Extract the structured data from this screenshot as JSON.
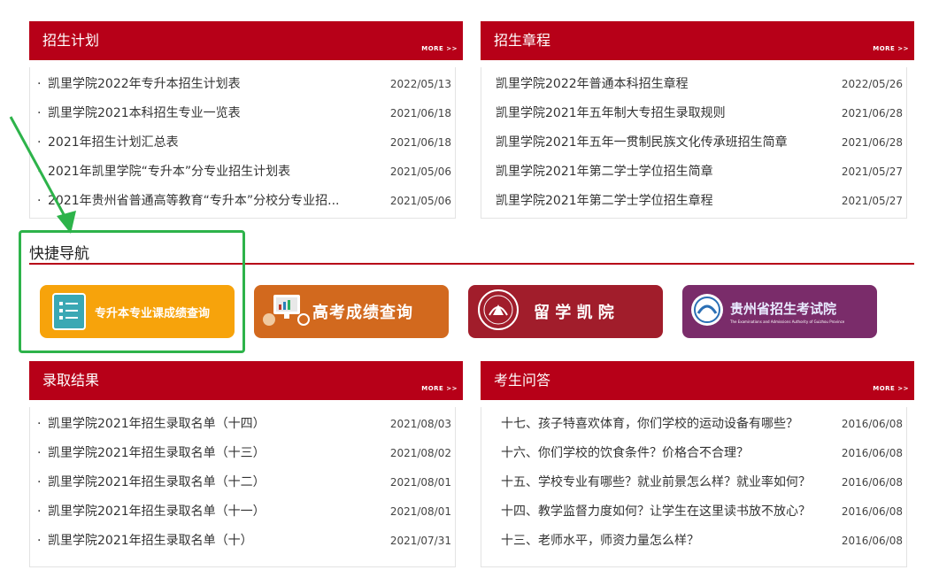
{
  "more_label": "MORE >>",
  "plan": {
    "title": "招生计划",
    "items": [
      {
        "title": "凯里学院2022年专升本招生计划表",
        "date": "2022/05/13"
      },
      {
        "title": "凯里学院2021本科招生专业一览表",
        "date": "2021/06/18"
      },
      {
        "title": "2021年招生计划汇总表",
        "date": "2021/06/18"
      },
      {
        "title": "2021年凯里学院“专升本”分专业招生计划表",
        "date": "2021/05/06"
      },
      {
        "title": "2021年贵州省普通高等教育“专升本”分校分专业招...",
        "date": "2021/05/06"
      }
    ]
  },
  "charter": {
    "title": "招生章程",
    "items": [
      {
        "title": "凯里学院2022年普通本科招生章程",
        "date": "2022/05/26"
      },
      {
        "title": "凯里学院2021年五年制大专招生录取规则",
        "date": "2021/06/28"
      },
      {
        "title": "凯里学院2021年五年一贯制民族文化传承班招生简章",
        "date": "2021/06/28"
      },
      {
        "title": "凯里学院2021年第二学士学位招生简章",
        "date": "2021/05/27"
      },
      {
        "title": "凯里学院2021年第二学士学位招生章程",
        "date": "2021/05/27"
      }
    ]
  },
  "quicknav": {
    "title": "快捷导航",
    "banners": [
      {
        "label": "专升本专业课成绩查询",
        "bg": "#f7a30b"
      },
      {
        "label": "高考成绩查询",
        "bg": "#d2691e"
      },
      {
        "label": "留 学 凯 院",
        "bg": "#a11d2b"
      },
      {
        "label": "贵州省招生考试院",
        "sub": "The Examinations and Admissions Authority of Guizhou Province",
        "bg": "#7a2c6a"
      }
    ]
  },
  "admission": {
    "title": "录取结果",
    "items": [
      {
        "title": "凯里学院2021年招生录取名单（十四）",
        "date": "2021/08/03"
      },
      {
        "title": "凯里学院2021年招生录取名单（十三）",
        "date": "2021/08/02"
      },
      {
        "title": "凯里学院2021年招生录取名单（十二）",
        "date": "2021/08/01"
      },
      {
        "title": "凯里学院2021年招生录取名单（十一）",
        "date": "2021/08/01"
      },
      {
        "title": "凯里学院2021年招生录取名单（十）",
        "date": "2021/07/31"
      }
    ]
  },
  "qa": {
    "title": "考生问答",
    "items": [
      {
        "title": "十七、孩子特喜欢体育，你们学校的运动设备有哪些？",
        "date": "2016/06/08"
      },
      {
        "title": "十六、你们学校的饮食条件？价格合不合理？",
        "date": "2016/06/08"
      },
      {
        "title": "十五、学校专业有哪些？就业前景怎么样？就业率如何？",
        "date": "2016/06/08"
      },
      {
        "title": "十四、教学监督力度如何？让学生在这里读书放不放心？",
        "date": "2016/06/08"
      },
      {
        "title": "十三、老师水平，师资力量怎么样？",
        "date": "2016/06/08"
      }
    ]
  }
}
